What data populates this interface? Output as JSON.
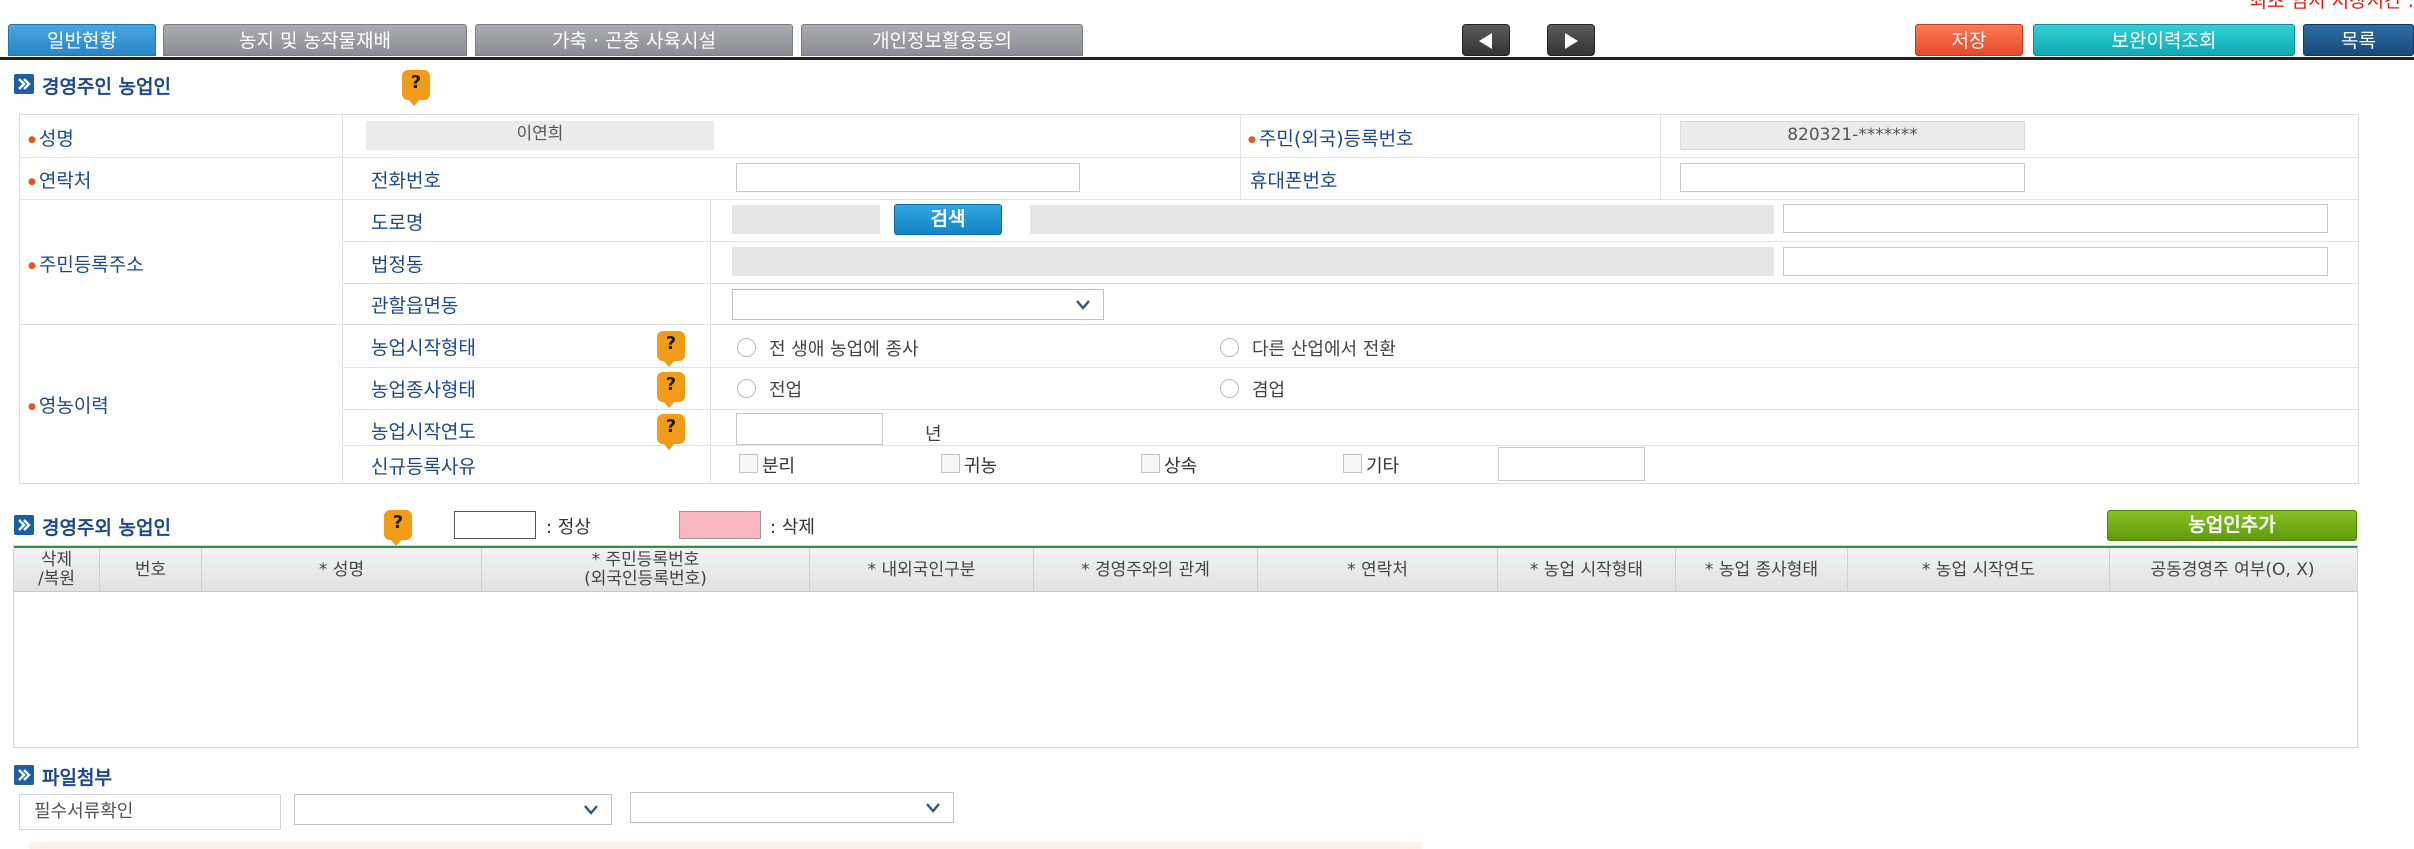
{
  "header": {
    "last_save": "최초 임시 저장시간 :",
    "tabs": [
      "일반현황",
      "농지 및 농작물재배",
      "가축 · 곤충 사육시설",
      "개인정보활용동의"
    ],
    "buttons": {
      "save": "저장",
      "history": "보완이력조회",
      "list": "목록"
    }
  },
  "owner_section": {
    "title": "경영주인 농업인",
    "help": "?",
    "name_label": "성명",
    "name_value": "이연희",
    "rrn_label": "주민(외국)등록번호",
    "rrn_value": "820321-*******",
    "contact_label": "연락처",
    "phone_label": "전화번호",
    "mobile_label": "휴대폰번호",
    "address_label": "주민등록주소",
    "road_label": "도로명",
    "search_button": "검색",
    "lot_label": "법정동",
    "district_label": "관할읍면동",
    "history_label": "영농이력",
    "start_type_label": "농업시작형태",
    "start_type_options": [
      "전 생애 농업에 종사",
      "다른 산업에서 전환"
    ],
    "work_type_label": "농업종사형태",
    "work_type_options": [
      "전업",
      "겸업"
    ],
    "start_year_label": "농업시작연도",
    "year_unit": "년",
    "reason_label": "신규등록사유",
    "reason_options": [
      "분리",
      "귀농",
      "상속",
      "기타"
    ]
  },
  "other_section": {
    "title": "경영주외 농업인",
    "help": "?",
    "legend_normal": ": 정상",
    "legend_delete": ": 삭제",
    "legend_colors": {
      "normal": "#ffffff",
      "delete": "#f9b6c1"
    },
    "add_button": "농업인추가",
    "columns": [
      [
        "삭제",
        "/복원"
      ],
      [
        "번호"
      ],
      [
        "* 성명"
      ],
      [
        "* 주민등록번호",
        "(외국인등록번호)"
      ],
      [
        "* 내외국인구분"
      ],
      [
        "* 경영주와의 관계"
      ],
      [
        "* 연락처"
      ],
      [
        "* 농업 시작형태"
      ],
      [
        "* 농업 종사형태"
      ],
      [
        "* 농업 시작연도"
      ],
      [
        "공동경영주 여부(O, X)"
      ]
    ]
  },
  "attach_section": {
    "title": "파일첨부",
    "required_docs_label": "필수서류확인"
  },
  "colors": {
    "accent_blue": "#1c5ea5",
    "label_blue": "#1c4a8a",
    "required_dot": "#e8541c",
    "help_orange": "#f29b16",
    "save_red": "#e5492a",
    "history_teal": "#10aab2",
    "add_green": "#5f9b0e"
  }
}
